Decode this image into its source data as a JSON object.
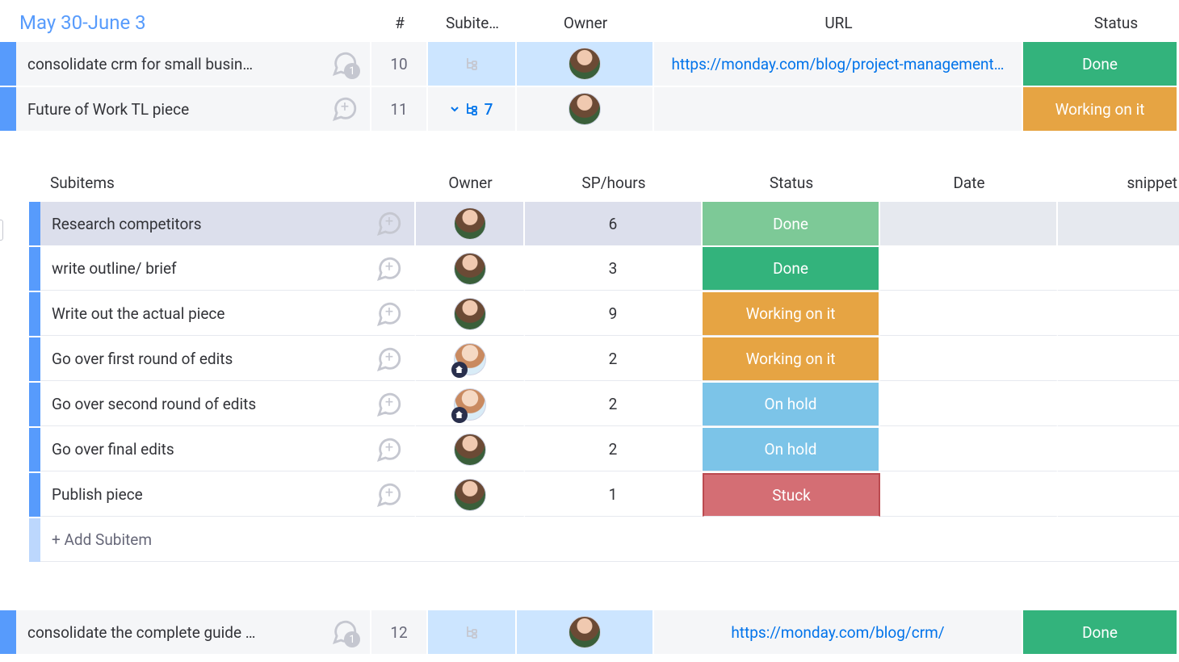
{
  "group": {
    "title": "May 30-June 3"
  },
  "columns": {
    "num": "#",
    "subitems": "Subite…",
    "owner": "Owner",
    "url": "URL",
    "status": "Status"
  },
  "status_labels": {
    "done": "Done",
    "working": "Working on it",
    "hold": "On hold",
    "stuck": "Stuck"
  },
  "rows": [
    {
      "title": "consolidate crm for small busin…",
      "comment_count": "1",
      "num": "10",
      "subitems_count": "",
      "subitems_expanded": false,
      "selected": true,
      "url": "https://monday.com/blog/project-management…",
      "url_full": "https://monday.com/blog/project-management…",
      "status": "done"
    },
    {
      "title": "Future of Work TL piece",
      "comment_count": "",
      "num": "11",
      "subitems_count": "7",
      "subitems_expanded": true,
      "selected": false,
      "url": "",
      "status": "working"
    }
  ],
  "sub_columns": {
    "title": "Subitems",
    "owner": "Owner",
    "sp": "SP/hours",
    "status": "Status",
    "date": "Date",
    "snippet": "snippet"
  },
  "subitems": [
    {
      "title": "Research competitors",
      "sp": "6",
      "status": "done",
      "owner": "a",
      "current": true
    },
    {
      "title": "write outline/ brief",
      "sp": "3",
      "status": "done",
      "owner": "a",
      "current": false
    },
    {
      "title": "Write out the actual piece",
      "sp": "9",
      "status": "working",
      "owner": "a",
      "current": false
    },
    {
      "title": "Go over first round of edits",
      "sp": "2",
      "status": "working",
      "owner": "b",
      "current": false
    },
    {
      "title": "Go over second round of edits",
      "sp": "2",
      "status": "hold",
      "owner": "b",
      "current": false
    },
    {
      "title": "Go over final edits",
      "sp": "2",
      "status": "hold",
      "owner": "a",
      "current": false
    },
    {
      "title": "Publish piece",
      "sp": "1",
      "status": "stuck",
      "owner": "a",
      "current": false
    }
  ],
  "add_subitem_label": "+ Add Subitem",
  "bottom_row": {
    "title": "consolidate the complete guide …",
    "comment_count": "1",
    "num": "12",
    "url": "https://monday.com/blog/crm/",
    "status": "done",
    "selected": true
  }
}
